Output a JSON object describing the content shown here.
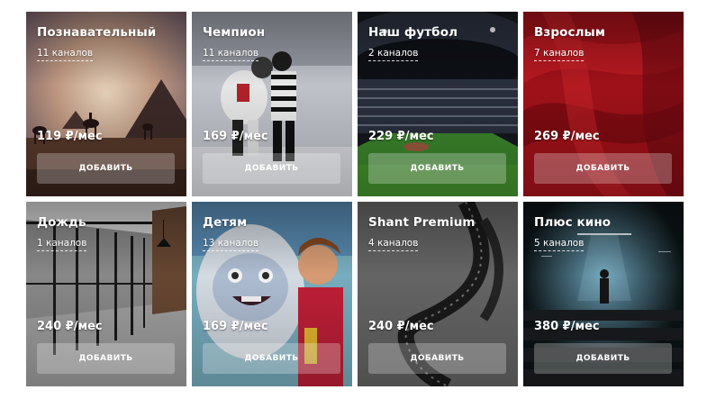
{
  "packages": [
    {
      "title": "Познавательный",
      "channels": "11 каналов",
      "price": "119 ₽/мес",
      "button": "ДОБАВИТЬ",
      "image": "egypt-pyramids-camels"
    },
    {
      "title": "Чемпион",
      "channels": "11 каналов",
      "price": "169 ₽/мес",
      "button": "ДОБАВИТЬ",
      "image": "ice-hockey-players"
    },
    {
      "title": "Наш футбол",
      "channels": "2 каналов",
      "price": "229 ₽/мес",
      "button": "ДОБАВИТЬ",
      "image": "football-stadium"
    },
    {
      "title": "Взрослым",
      "channels": "7 каналов",
      "price": "269 ₽/мес",
      "button": "ДОБАВИТЬ",
      "image": "red-silk"
    },
    {
      "title": "Дождь",
      "channels": "1 каналов",
      "price": "240 ₽/мес",
      "button": "ДОБАВИТЬ",
      "image": "office-interior"
    },
    {
      "title": "Детям",
      "channels": "13 каналов",
      "price": "169 ₽/мес",
      "button": "ДОБАВИТЬ",
      "image": "cartoon-yeti-boy"
    },
    {
      "title": "Shant Premium",
      "channels": "4 каналов",
      "price": "240 ₽/мес",
      "button": "ДОБАВИТЬ",
      "image": "film-strip"
    },
    {
      "title": "Плюс кино",
      "channels": "5 каналов",
      "price": "380 ₽/мес",
      "button": "ДОБАВИТЬ",
      "image": "cinema-hall"
    }
  ]
}
